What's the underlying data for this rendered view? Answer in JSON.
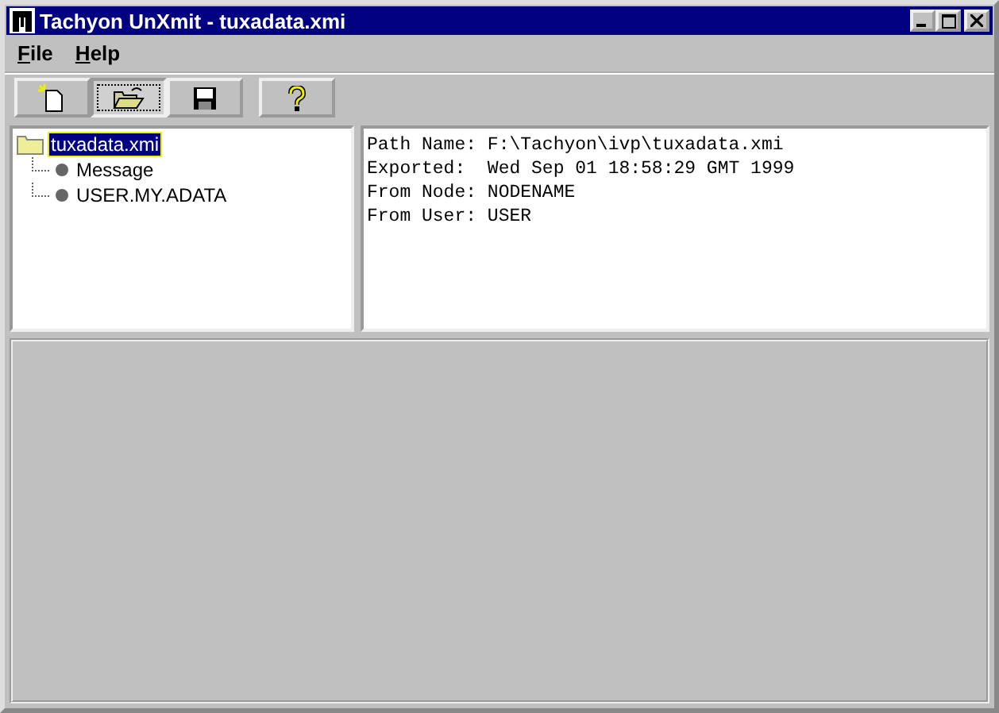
{
  "window": {
    "title": "Tachyon UnXmit - tuxadata.xmi"
  },
  "menu": [
    "File",
    "Help"
  ],
  "toolbar": [
    {
      "kind": "new",
      "pressed": false
    },
    {
      "kind": "open",
      "pressed": true
    },
    {
      "kind": "save",
      "pressed": false
    },
    {
      "kind": "help",
      "pressed": false
    }
  ],
  "tree": {
    "label": "tuxadata.xmi",
    "selected": true,
    "children": [
      {
        "label": "Message",
        "selected": false
      },
      {
        "label": "USER.MY.ADATA",
        "selected": false
      }
    ]
  },
  "details": [
    "Path Name: F:\\Tachyon\\ivp\\tuxadata.xmi",
    "Exported:  Wed Sep 01 18:58:29 GMT 1999",
    "From Node: NODENAME",
    "From User: USER"
  ]
}
